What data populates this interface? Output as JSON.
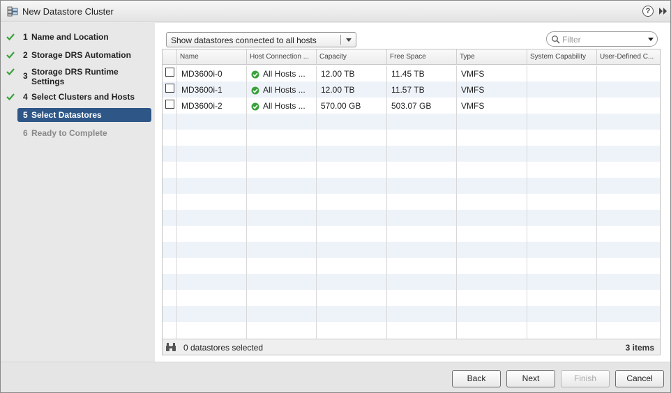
{
  "window": {
    "title": "New Datastore Cluster",
    "help_glyph": "?"
  },
  "nav": {
    "items": [
      {
        "num": "1",
        "label": "Name and Location",
        "state": "done"
      },
      {
        "num": "2",
        "label": "Storage DRS Automation",
        "state": "done"
      },
      {
        "num": "3",
        "label": "Storage DRS Runtime Settings",
        "state": "done"
      },
      {
        "num": "4",
        "label": "Select Clusters and Hosts",
        "state": "done"
      },
      {
        "num": "5",
        "label": "Select Datastores",
        "state": "active"
      },
      {
        "num": "6",
        "label": "Ready to Complete",
        "state": "disabled"
      }
    ]
  },
  "toolbar": {
    "view_select": "Show datastores connected to all hosts",
    "filter_placeholder": "Filter"
  },
  "grid": {
    "columns": [
      "Name",
      "Host Connection ...",
      "Capacity",
      "Free Space",
      "Type",
      "System Capability",
      "User-Defined C..."
    ],
    "rows": [
      {
        "name": "MD3600i-0",
        "host_connection": "All Hosts ...",
        "capacity": "12.00 TB",
        "free_space": "11.45 TB",
        "type": "VMFS",
        "system_capability": "",
        "user_defined": ""
      },
      {
        "name": "MD3600i-1",
        "host_connection": "All Hosts ...",
        "capacity": "12.00 TB",
        "free_space": "11.57 TB",
        "type": "VMFS",
        "system_capability": "",
        "user_defined": ""
      },
      {
        "name": "MD3600i-2",
        "host_connection": "All Hosts ...",
        "capacity": "570.00 GB",
        "free_space": "503.07 GB",
        "type": "VMFS",
        "system_capability": "",
        "user_defined": ""
      }
    ],
    "footer": {
      "selected_text": "0 datastores selected",
      "items_text": "3 items"
    }
  },
  "buttons": {
    "back": "Back",
    "next": "Next",
    "finish": "Finish",
    "cancel": "Cancel"
  },
  "colors": {
    "accent": "#2e5687",
    "check": "#3aa03a",
    "row_alt": "#eef3fa"
  },
  "icons": {
    "title": "datastore-cluster-icon",
    "help": "help-icon",
    "expand": "double-chevron-right-icon",
    "step_done": "checkmark-icon",
    "filter": "search-icon",
    "connection_ok": "green-check-circle-icon",
    "footer": "binoculars-icon"
  }
}
